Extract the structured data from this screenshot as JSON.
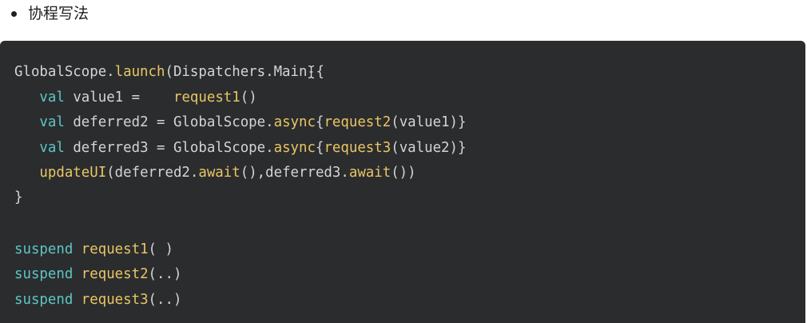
{
  "heading": {
    "bullet_text": "协程写法"
  },
  "code": {
    "lines": [
      {
        "tokens": [
          {
            "text": "GlobalScope.",
            "kind": "plain"
          },
          {
            "text": "launch",
            "kind": "fn"
          },
          {
            "text": "(Dispatchers.Main",
            "kind": "plain"
          },
          {
            "text": "{",
            "kind": "plain"
          }
        ]
      },
      {
        "tokens": [
          {
            "text": "   ",
            "kind": "plain"
          },
          {
            "text": "val",
            "kind": "kw"
          },
          {
            "text": " value1 =    ",
            "kind": "plain"
          },
          {
            "text": "request1",
            "kind": "fn"
          },
          {
            "text": "()",
            "kind": "plain"
          }
        ]
      },
      {
        "tokens": [
          {
            "text": "   ",
            "kind": "plain"
          },
          {
            "text": "val",
            "kind": "kw"
          },
          {
            "text": " deferred2 = GlobalScope.",
            "kind": "plain"
          },
          {
            "text": "async",
            "kind": "fn"
          },
          {
            "text": "{",
            "kind": "plain"
          },
          {
            "text": "request2",
            "kind": "fn"
          },
          {
            "text": "(value1)}",
            "kind": "plain"
          }
        ]
      },
      {
        "tokens": [
          {
            "text": "   ",
            "kind": "plain"
          },
          {
            "text": "val",
            "kind": "kw"
          },
          {
            "text": " deferred3 = GlobalScope.",
            "kind": "plain"
          },
          {
            "text": "async",
            "kind": "fn"
          },
          {
            "text": "{",
            "kind": "plain"
          },
          {
            "text": "request3",
            "kind": "fn"
          },
          {
            "text": "(value2)}",
            "kind": "plain"
          }
        ]
      },
      {
        "tokens": [
          {
            "text": "   ",
            "kind": "plain"
          },
          {
            "text": "updateUI",
            "kind": "fn"
          },
          {
            "text": "(deferred2.",
            "kind": "plain"
          },
          {
            "text": "await",
            "kind": "fn"
          },
          {
            "text": "(),deferred3.",
            "kind": "plain"
          },
          {
            "text": "await",
            "kind": "fn"
          },
          {
            "text": "())",
            "kind": "plain"
          }
        ]
      },
      {
        "tokens": [
          {
            "text": "}",
            "kind": "plain"
          }
        ]
      },
      {
        "tokens": []
      },
      {
        "tokens": [
          {
            "text": "suspend",
            "kind": "kw"
          },
          {
            "text": " ",
            "kind": "plain"
          },
          {
            "text": "request1",
            "kind": "fn"
          },
          {
            "text": "( )",
            "kind": "plain"
          }
        ]
      },
      {
        "tokens": [
          {
            "text": "suspend",
            "kind": "kw"
          },
          {
            "text": " ",
            "kind": "plain"
          },
          {
            "text": "request2",
            "kind": "fn"
          },
          {
            "text": "(..)",
            "kind": "plain"
          }
        ]
      },
      {
        "tokens": [
          {
            "text": "suspend",
            "kind": "kw"
          },
          {
            "text": " ",
            "kind": "plain"
          },
          {
            "text": "request3",
            "kind": "fn"
          },
          {
            "text": "(..)",
            "kind": "plain"
          }
        ]
      }
    ]
  },
  "colors": {
    "code_background": "#2b2c2e",
    "keyword": "#5cc7c6",
    "function": "#e9c664",
    "plain": "#d4d4d4"
  },
  "icons": {
    "cursor": "text-cursor-icon"
  }
}
